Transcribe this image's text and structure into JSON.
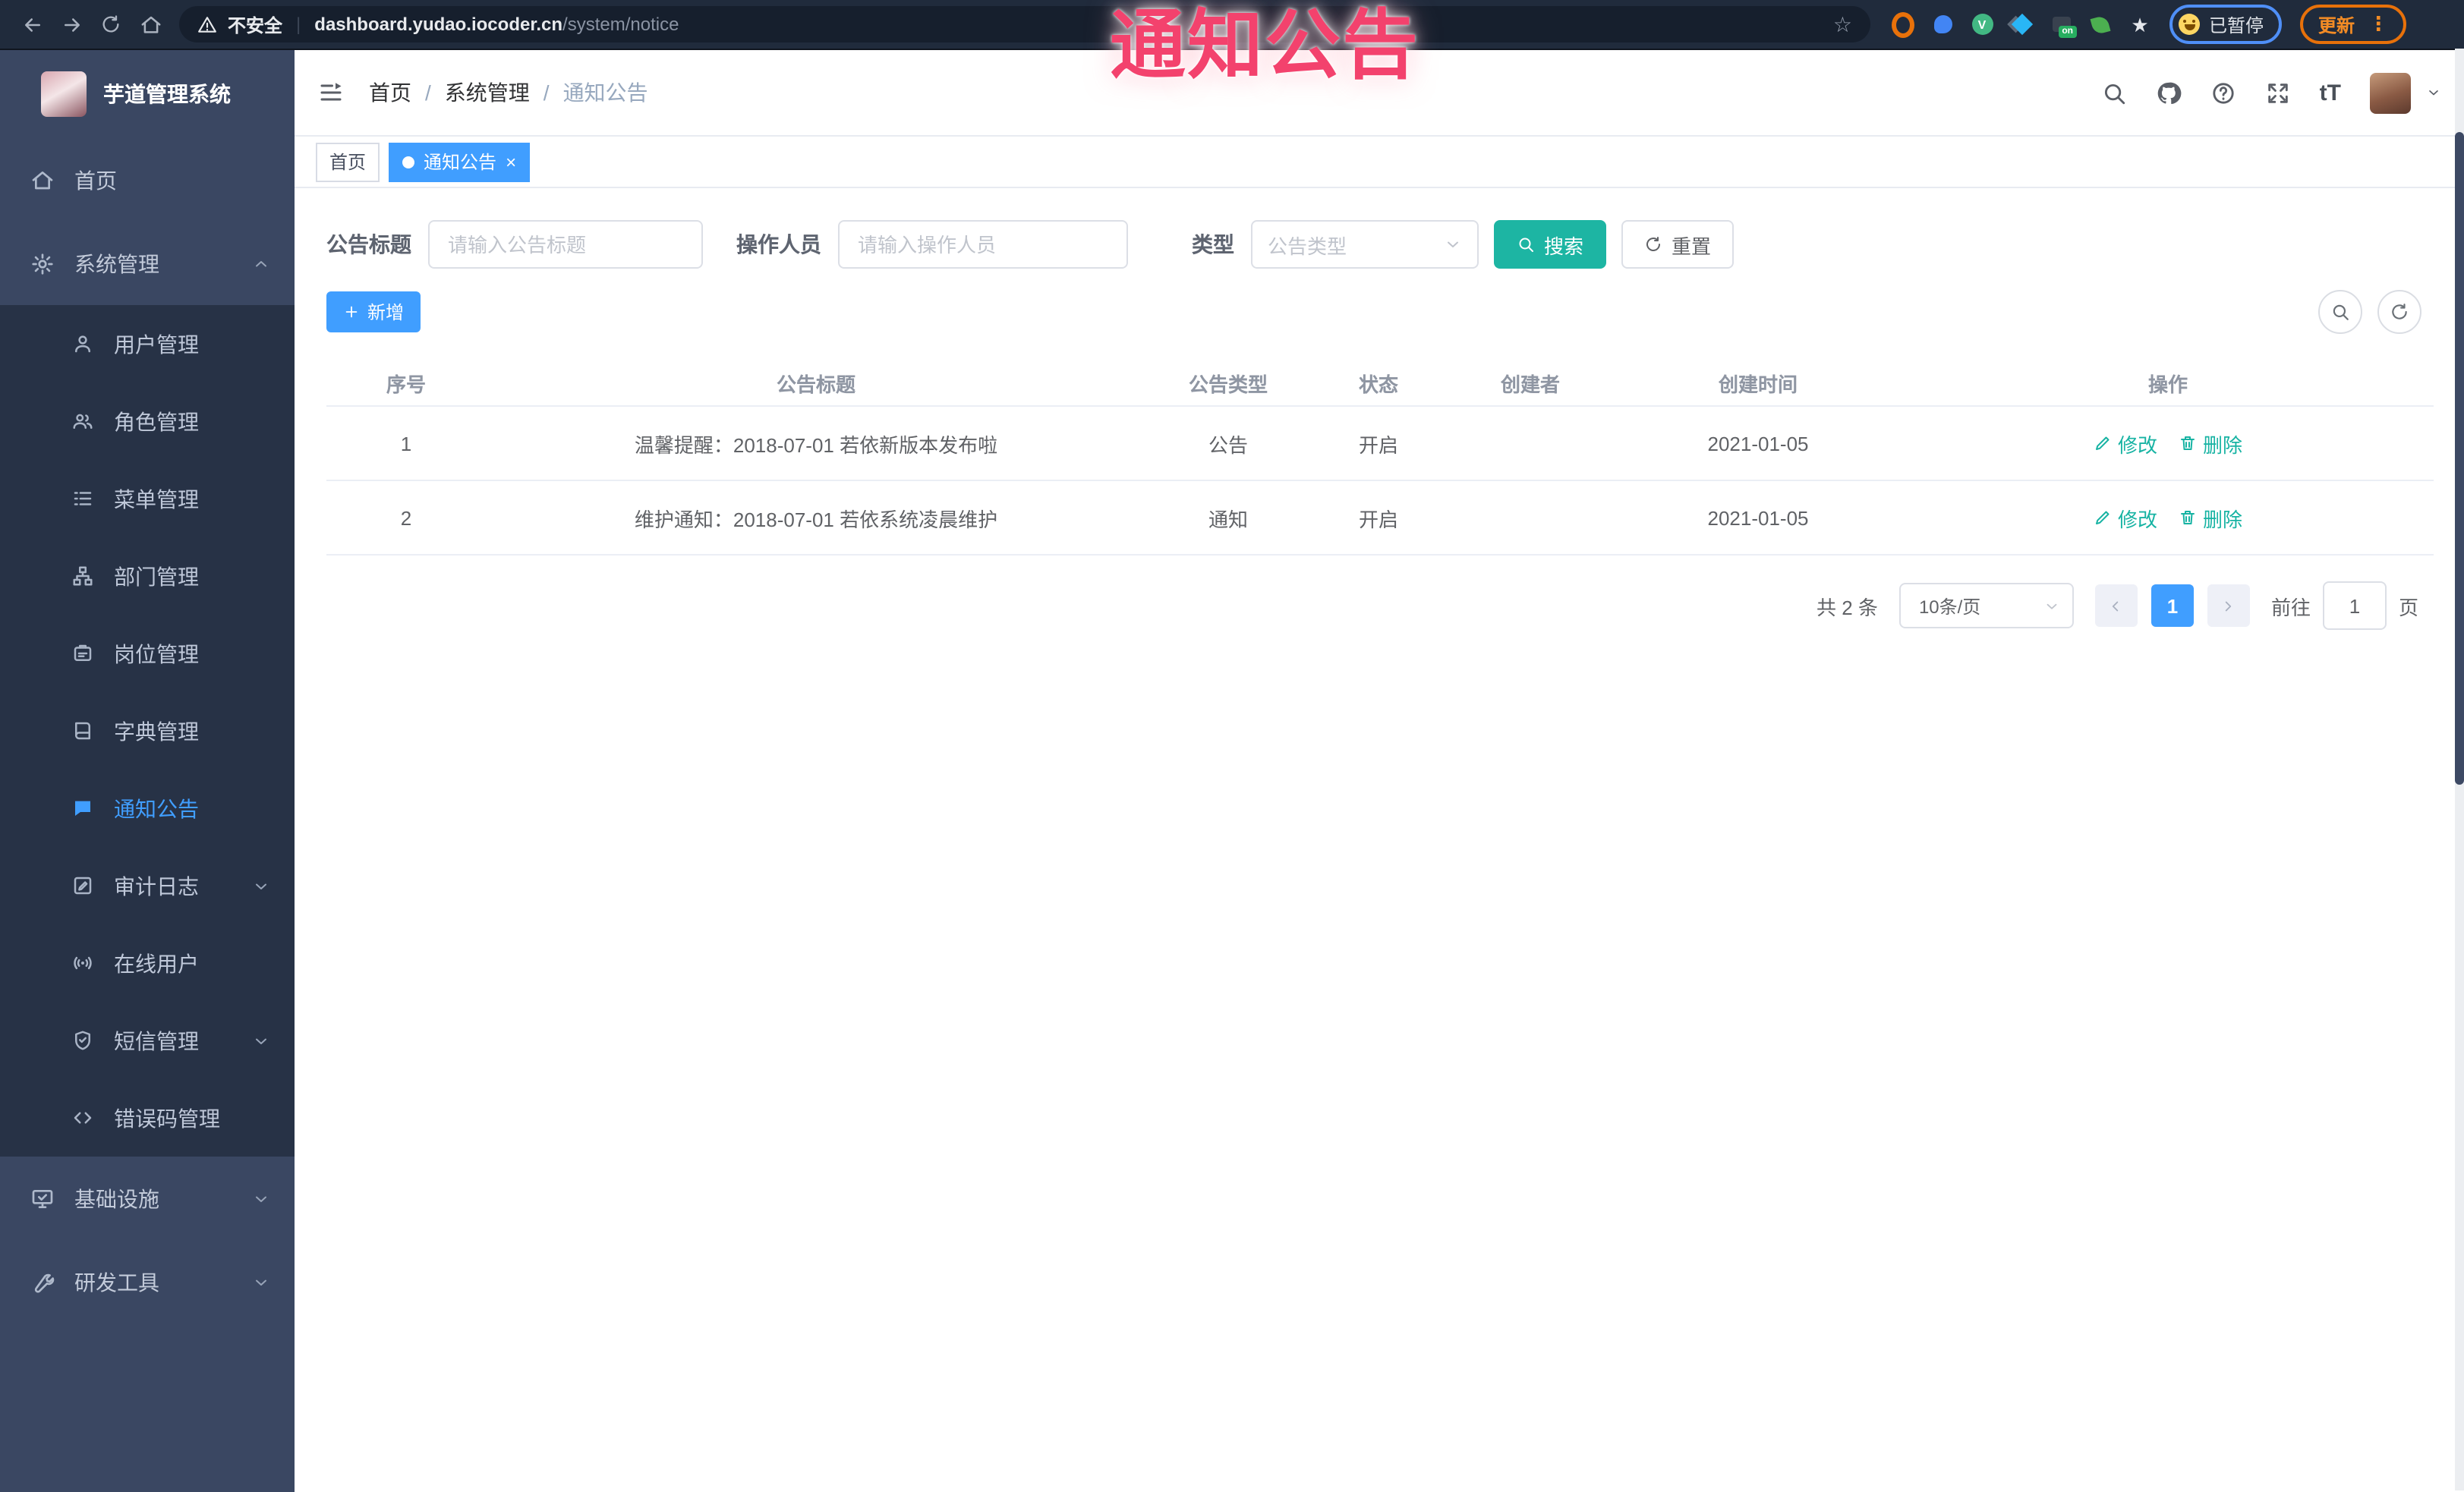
{
  "browser": {
    "security_label": "不安全",
    "url_host": "dashboard.yudao.iocoder.cn",
    "url_path": "/system/notice",
    "paused_chip": "已暂停",
    "update_button": "更新",
    "extensions": [
      "orange-ring-extension",
      "blue-pin-extension",
      "vue-devtools-extension",
      "gem-extension",
      "stack-on-extension",
      "leaf-extension",
      "puzzle-extension"
    ]
  },
  "overlay": {
    "annotation": "通知公告"
  },
  "sidebar": {
    "logo_title": "芋道管理系统",
    "top_items": [
      {
        "label": "首页",
        "icon": "home-icon"
      },
      {
        "label": "系统管理",
        "icon": "gear-icon",
        "state": "expanded"
      }
    ],
    "submenu": [
      {
        "label": "用户管理",
        "icon": "user-icon"
      },
      {
        "label": "角色管理",
        "icon": "users-icon"
      },
      {
        "label": "菜单管理",
        "icon": "menu-list-icon"
      },
      {
        "label": "部门管理",
        "icon": "org-tree-icon"
      },
      {
        "label": "岗位管理",
        "icon": "badge-icon"
      },
      {
        "label": "字典管理",
        "icon": "dictionary-icon"
      },
      {
        "label": "通知公告",
        "icon": "announcement-icon",
        "active": true
      },
      {
        "label": "审计日志",
        "icon": "audit-log-icon",
        "state": "collapsed"
      },
      {
        "label": "在线用户",
        "icon": "online-users-icon"
      },
      {
        "label": "短信管理",
        "icon": "sms-icon",
        "state": "collapsed"
      },
      {
        "label": "错误码管理",
        "icon": "error-code-icon"
      }
    ],
    "bottom_items": [
      {
        "label": "基础设施",
        "icon": "infrastructure-icon",
        "state": "collapsed"
      },
      {
        "label": "研发工具",
        "icon": "dev-tools-icon",
        "state": "collapsed"
      }
    ]
  },
  "navbar": {
    "breadcrumb": [
      "首页",
      "系统管理",
      "通知公告"
    ],
    "font_size_icon": "tT"
  },
  "tags": [
    {
      "label": "首页",
      "active": false
    },
    {
      "label": "通知公告",
      "active": true,
      "close": "×"
    }
  ],
  "filters": {
    "title_label": "公告标题",
    "title_placeholder": "请输入公告标题",
    "operator_label": "操作人员",
    "operator_placeholder": "请输入操作人员",
    "type_label": "类型",
    "type_placeholder": "公告类型",
    "search_label": "搜索",
    "reset_label": "重置"
  },
  "toolbar": {
    "add_label": "新增"
  },
  "table": {
    "columns": [
      "序号",
      "公告标题",
      "公告类型",
      "状态",
      "创建者",
      "创建时间",
      "操作"
    ],
    "action_edit": "修改",
    "action_delete": "删除",
    "rows": [
      {
        "no": "1",
        "title": "温馨提醒：2018-07-01 若依新版本发布啦",
        "type": "公告",
        "status": "开启",
        "creator": "",
        "create_time": "2021-01-05"
      },
      {
        "no": "2",
        "title": "维护通知：2018-07-01 若依系统凌晨维护",
        "type": "通知",
        "status": "开启",
        "creator": "",
        "create_time": "2021-01-05"
      }
    ]
  },
  "pagination": {
    "total_text": "共 2 条",
    "page_size": "10条/页",
    "current_page": "1",
    "goto_label": "前往",
    "goto_value": "1",
    "page_unit": "页"
  },
  "colors": {
    "primary": "#409EFF",
    "teal_accent": "#1db5a3",
    "annotation_red": "#f3426d",
    "sidebar_bg": "#3a4762",
    "submenu_bg": "#273246"
  }
}
